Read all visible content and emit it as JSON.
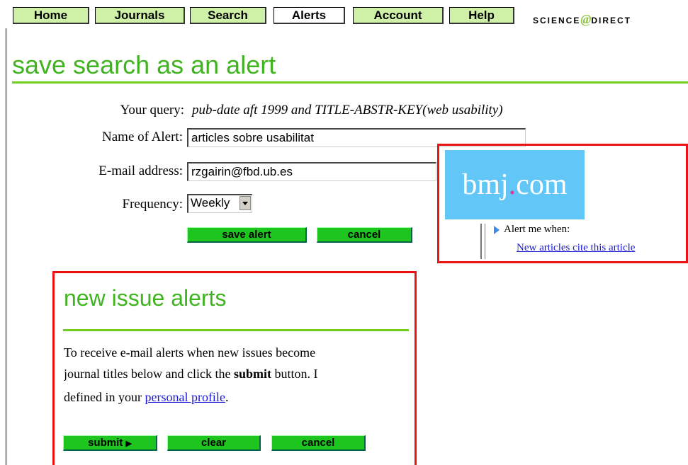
{
  "nav": {
    "tabs": [
      "Home",
      "Journals",
      "Search",
      "Alerts",
      "Account",
      "Help"
    ],
    "brand_left": "SCIENCE",
    "brand_at": "@",
    "brand_right": "DIRECT"
  },
  "page_title": "save search as an alert",
  "form": {
    "query_label": "Your query:",
    "query_value": "pub-date aft 1999 and TITLE-ABSTR-KEY(web usability)",
    "name_label": "Name of Alert:",
    "name_value": "articles sobre usabilitat",
    "email_label": "E-mail address:",
    "email_value": "rzgairin@fbd.ub.es",
    "frequency_label": "Frequency:",
    "frequency_value": "Weekly",
    "save_label": "save alert",
    "cancel_label": "cancel"
  },
  "bmj": {
    "logo_left": "bmj",
    "logo_dot": ".",
    "logo_right": "com",
    "alert_text": "Alert me when:",
    "alert_link": "New articles cite this article"
  },
  "new_issue": {
    "title": "new issue alerts",
    "line1": "To receive e-mail alerts when new issues become",
    "line2_before": "journal titles below and click the ",
    "line2_bold": "submit",
    "line2_after": " button. I",
    "line3_before": "defined in your ",
    "line3_link": "personal profile",
    "line3_after": ".",
    "submit_label": "submit",
    "clear_label": "clear",
    "cancel_label": "cancel"
  },
  "colors": {
    "accent_green": "#3fb41f",
    "button_green": "#1ec51e",
    "highlight_red": "#e11111"
  }
}
